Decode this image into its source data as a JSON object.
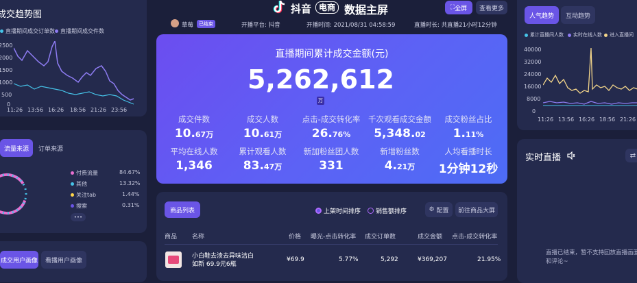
{
  "left_trend": {
    "title": "成交趋势图",
    "legend": [
      "直播期间成交订单数",
      "直播期间成交件数"
    ],
    "yticks": [
      "2500",
      "2000",
      "1500",
      "1000",
      "500",
      "0"
    ],
    "xticks": [
      "11:26",
      "13:56",
      "16:26",
      "18:56",
      "21:26",
      "23:56"
    ]
  },
  "traffic": {
    "tabs": [
      "流量来源",
      "订单来源"
    ],
    "items": [
      {
        "label": "付费流量",
        "value": "84.67%",
        "color": "#e86fd0"
      },
      {
        "label": "其他",
        "value": "13.32%",
        "color": "#46c3e8"
      },
      {
        "label": "关注tab",
        "value": "1.44%",
        "color": "#ffd54a"
      },
      {
        "label": "搜索",
        "value": "0.31%",
        "color": "#6a55e6"
      }
    ],
    "more": "•••"
  },
  "persona": {
    "tabs": [
      "成交用户画像",
      "看播用户画像"
    ]
  },
  "brand": {
    "logo_icon": "tiktok-logo-icon",
    "name1": "抖音",
    "badge": "电商",
    "title": "数据主屏",
    "fullscreen": "全屏",
    "more": "查看更多"
  },
  "info": {
    "host": "草莓",
    "status": "已结束",
    "platform": "开播平台: 抖音",
    "start": "开播时间: 2021/08/31 04:58:59",
    "duration": "直播时长: 共直播21小时12分钟"
  },
  "gmv": {
    "label": "直播期间累计成交金额(元)",
    "value": "5,262,612",
    "unit": "万"
  },
  "metrics": [
    {
      "label": "成交件数",
      "value": "10.",
      "small": "67万"
    },
    {
      "label": "成交人数",
      "value": "10.",
      "small": "61万"
    },
    {
      "label": "点击-成交转化率",
      "value": "26.",
      "small": "76%"
    },
    {
      "label": "千次观看成交金额",
      "value": "5,348.",
      "small": "02"
    },
    {
      "label": "成交粉丝占比",
      "value": "1.",
      "small": "11%"
    },
    {
      "label": "平均在线人数",
      "value": "1,346",
      "small": ""
    },
    {
      "label": "累计观看人数",
      "value": "83.",
      "small": "47万"
    },
    {
      "label": "新加粉丝团人数",
      "value": "331",
      "small": ""
    },
    {
      "label": "新增粉丝数",
      "value": "4.",
      "small": "21万"
    },
    {
      "label": "人均看播时长",
      "value": "1分钟12秒",
      "small": ""
    }
  ],
  "products": {
    "tab": "商品列表",
    "sort1": "上架时间排序",
    "sort2": "销售额排序",
    "config": "配置",
    "big": "前往商品大屏",
    "headers": [
      "商品",
      "名称",
      "价格",
      "曝光-点击转化率",
      "成交订单数",
      "成交金额",
      "点击-成交转化率"
    ],
    "rows": [
      {
        "name": "小白鞋去渍去异味洁白如新 69.9元6瓶",
        "price": "¥69.9",
        "ctr": "5.77%",
        "orders": "5,292",
        "amount": "¥369,207",
        "cvr": "21.95%"
      }
    ]
  },
  "right_trend": {
    "tabs": [
      "人气趋势",
      "互动趋势"
    ],
    "legend": [
      "累计直播间人数",
      "实时在线人数",
      "进入直播间"
    ],
    "yticks": [
      "40000",
      "32000",
      "24000",
      "16000",
      "8000",
      "0"
    ],
    "xticks": [
      "11:26",
      "13:56",
      "16:26",
      "18:56",
      "21:26"
    ]
  },
  "live": {
    "title": "实时直播",
    "msg": "直播已结束，暂不支持回放直播画面和评论~"
  }
}
